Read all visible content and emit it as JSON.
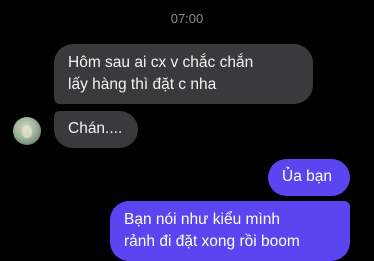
{
  "chat": {
    "timestamp": "07:00",
    "messages": [
      {
        "sender": "them",
        "text": "Hôm sau ai cx v chắc chắn\nlấy hàng thì đặt c nha"
      },
      {
        "sender": "them",
        "text": "Chán...."
      },
      {
        "sender": "me",
        "text": "Ủa bạn"
      },
      {
        "sender": "me",
        "text": "Bạn nói như kiểu mình\nrảnh đi đặt xong rồi boom"
      }
    ]
  },
  "colors": {
    "background": "#000000",
    "incoming_bubble": "#3a3a3c",
    "outgoing_bubble": "#5b45f1",
    "timestamp": "#8e8e93"
  },
  "icons": {
    "contact_avatar": "avatar"
  }
}
